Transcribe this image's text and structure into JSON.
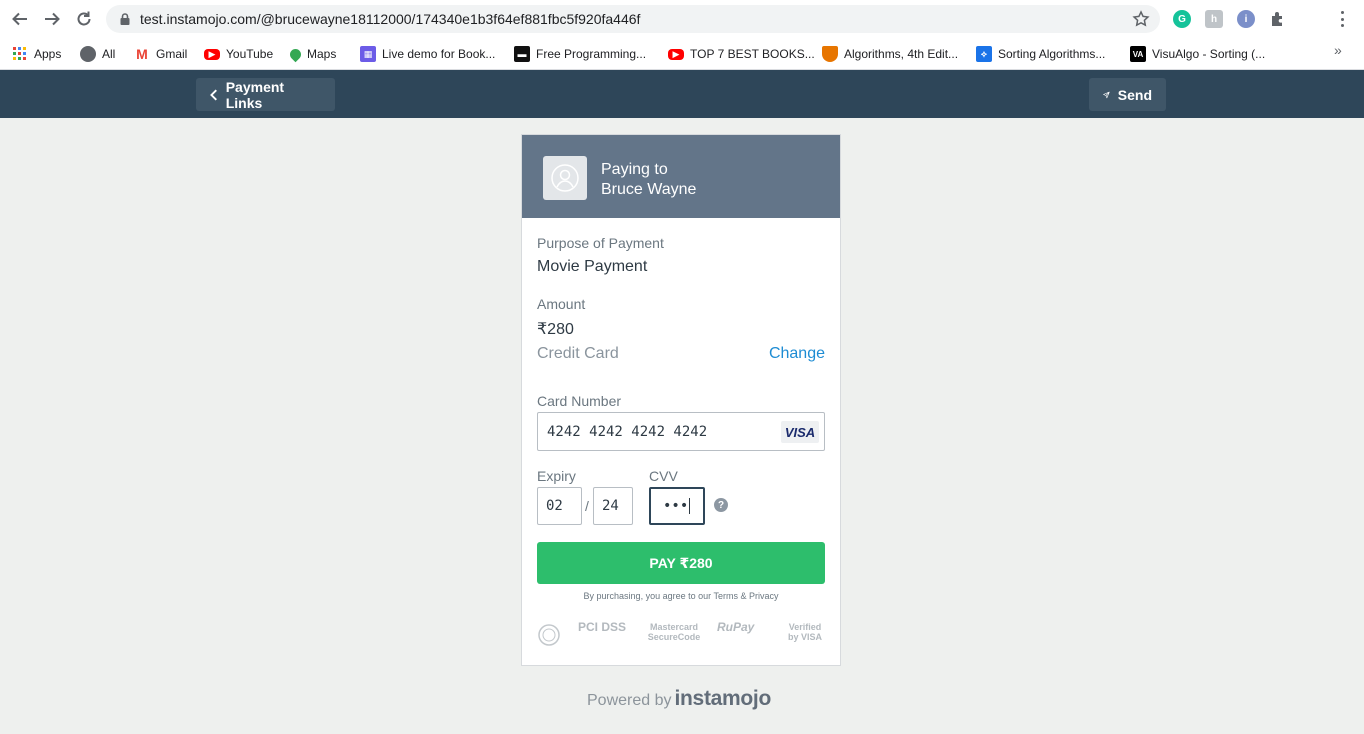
{
  "browser": {
    "url": "test.instamojo.com/@brucewayne18112000/174340e1b3f64ef881fbc5f920fa446f",
    "bookmarks": [
      {
        "label": "Apps",
        "icon": "apps-grid-icon"
      },
      {
        "label": "All",
        "icon": "globe-icon"
      },
      {
        "label": "Gmail",
        "icon": "gmail-icon"
      },
      {
        "label": "YouTube",
        "icon": "youtube-icon"
      },
      {
        "label": "Maps",
        "icon": "maps-pin-icon"
      },
      {
        "label": "Live demo for Book...",
        "icon": "calendar-icon"
      },
      {
        "label": "Free Programming...",
        "icon": "book-icon"
      },
      {
        "label": "TOP 7 BEST BOOKS...",
        "icon": "youtube-icon"
      },
      {
        "label": "Algorithms, 4th Edit...",
        "icon": "princeton-shield-icon"
      },
      {
        "label": "Sorting Algorithms...",
        "icon": "sorting-icon"
      },
      {
        "label": "VisuAlgo - Sorting (...",
        "icon": "visualgo-icon"
      }
    ],
    "more_bookmarks_icon": "chevron-double-right-icon"
  },
  "header": {
    "back_label": "Payment Links",
    "send_label": "Send"
  },
  "payment": {
    "paying_to_label": "Paying to",
    "payee": "Bruce Wayne",
    "purpose_label": "Purpose of Payment",
    "purpose_value": "Movie Payment",
    "amount_label": "Amount",
    "amount_value": "₹280",
    "method_label": "Credit Card",
    "change_label": "Change",
    "card_number_label": "Card Number",
    "card_number_value": "4242 4242 4242 4242",
    "card_brand": "VISA",
    "expiry_label": "Expiry",
    "expiry_month": "02",
    "expiry_separator": "/",
    "expiry_year": "24",
    "cvv_label": "CVV",
    "cvv_value": "•••",
    "cvv_help": "?",
    "pay_button": "PAY ₹280",
    "terms_text": "By purchasing, you agree to our Terms & Privacy",
    "trust_badges": [
      "PCI DSS",
      "Mastercard SecureCode",
      "RuPay",
      "Verified by VISA"
    ]
  },
  "footer": {
    "powered_by": "Powered by",
    "brand": "instamojo"
  },
  "colors": {
    "header_bg": "#2e4659",
    "card_head_bg": "#637589",
    "pay_green": "#2dbe6c",
    "link_blue": "#1e8cd3",
    "page_bg": "#eef0ee"
  }
}
